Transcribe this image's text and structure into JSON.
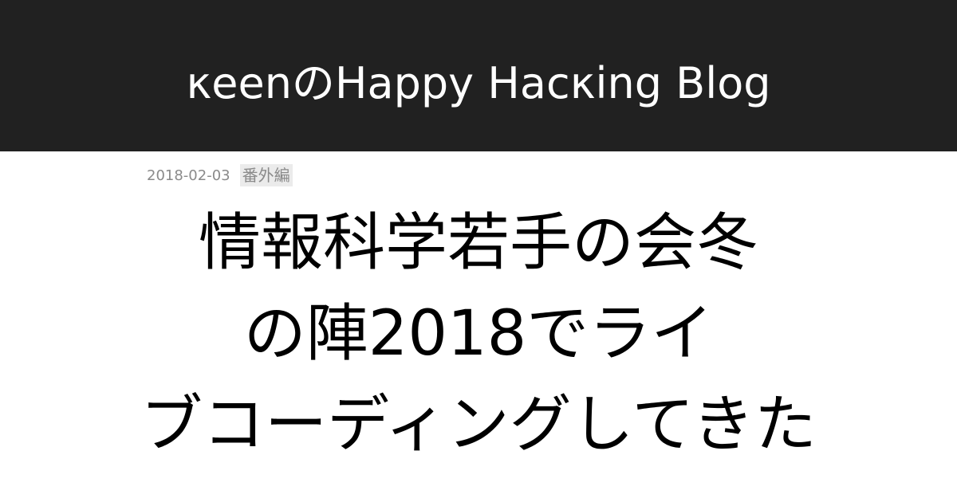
{
  "header": {
    "blog_title": "κeenのHappy Hacκing Blog",
    "background_color": "#212121",
    "text_color": "#ffffff"
  },
  "post": {
    "date": "2018-02-03",
    "category": "番外編",
    "title_lines": [
      "情報科学若手の会冬",
      "の陣2018でライ",
      "ブコーディングしてきた"
    ]
  }
}
